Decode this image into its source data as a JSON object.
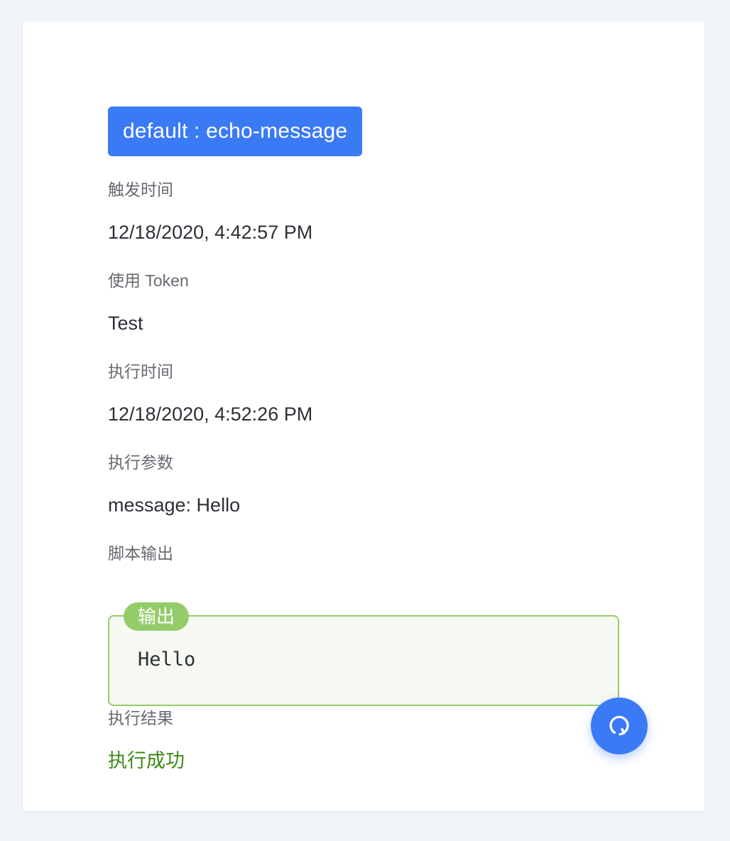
{
  "job": {
    "tag": "default : echo-message"
  },
  "fields": {
    "trigger_time": {
      "label": "触发时间",
      "value": "12/18/2020, 4:42:57 PM"
    },
    "token": {
      "label": "使用 Token",
      "value": "Test"
    },
    "exec_time": {
      "label": "执行时间",
      "value": "12/18/2020, 4:52:26 PM"
    },
    "params": {
      "label": "执行参数",
      "value": "message: Hello"
    },
    "script_output": {
      "label": "脚本输出",
      "badge": "输出",
      "text": "Hello"
    },
    "result": {
      "label": "执行结果",
      "value": "执行成功"
    }
  },
  "colors": {
    "accent": "#3b7af5",
    "success": "#3a8b16",
    "output_border": "#95cc6a",
    "output_bg": "#f5f9f1",
    "page_bg": "#f1f4f9"
  },
  "icons": {
    "fab": "refresh-icon"
  }
}
